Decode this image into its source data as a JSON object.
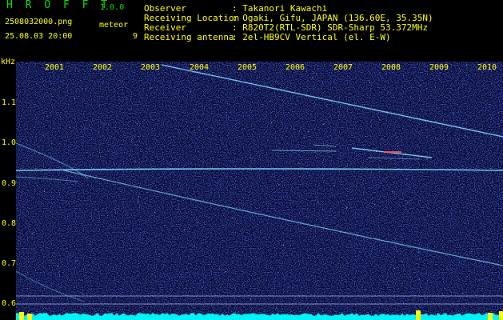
{
  "header": {
    "app_title": "H R O F F T",
    "version": "1.0.0",
    "filename": "2508032000.png",
    "timestamp": "25.08.03 20:00",
    "count_label": "meteor",
    "count_value": "9"
  },
  "info": [
    {
      "key": "Observer",
      "value": ": Takanori Kawachi"
    },
    {
      "key": "Receiving Location",
      "value": ": Ogaki, Gifu, JAPAN (136.60E, 35.35N)"
    },
    {
      "key": "Receiver",
      "value": ": R820T2(RTL-SDR) SDR-Sharp 53.372MHz"
    },
    {
      "key": "Receiving antenna",
      "value": ": 2el-HB9CV Vertical (el. E-W)"
    }
  ],
  "axis": {
    "y_unit": "kHz",
    "y_ticks": [
      "1.1",
      "1.0",
      "0.9",
      "0.8",
      "0.7",
      "0.6"
    ],
    "x_ticks": [
      "2001",
      "2002",
      "2003",
      "2004",
      "2005",
      "2006",
      "2007",
      "2008",
      "2009",
      "2010"
    ]
  },
  "colors": {
    "background": "#000000",
    "text": "#ffff00",
    "title": "#00e000",
    "plot_bg": "#06062e",
    "noise": "#1e3cff",
    "signal": "#7fd4ff",
    "signal_hot": "#ff5050",
    "baseline": "#00ffff",
    "peak": "#ffff00"
  }
}
